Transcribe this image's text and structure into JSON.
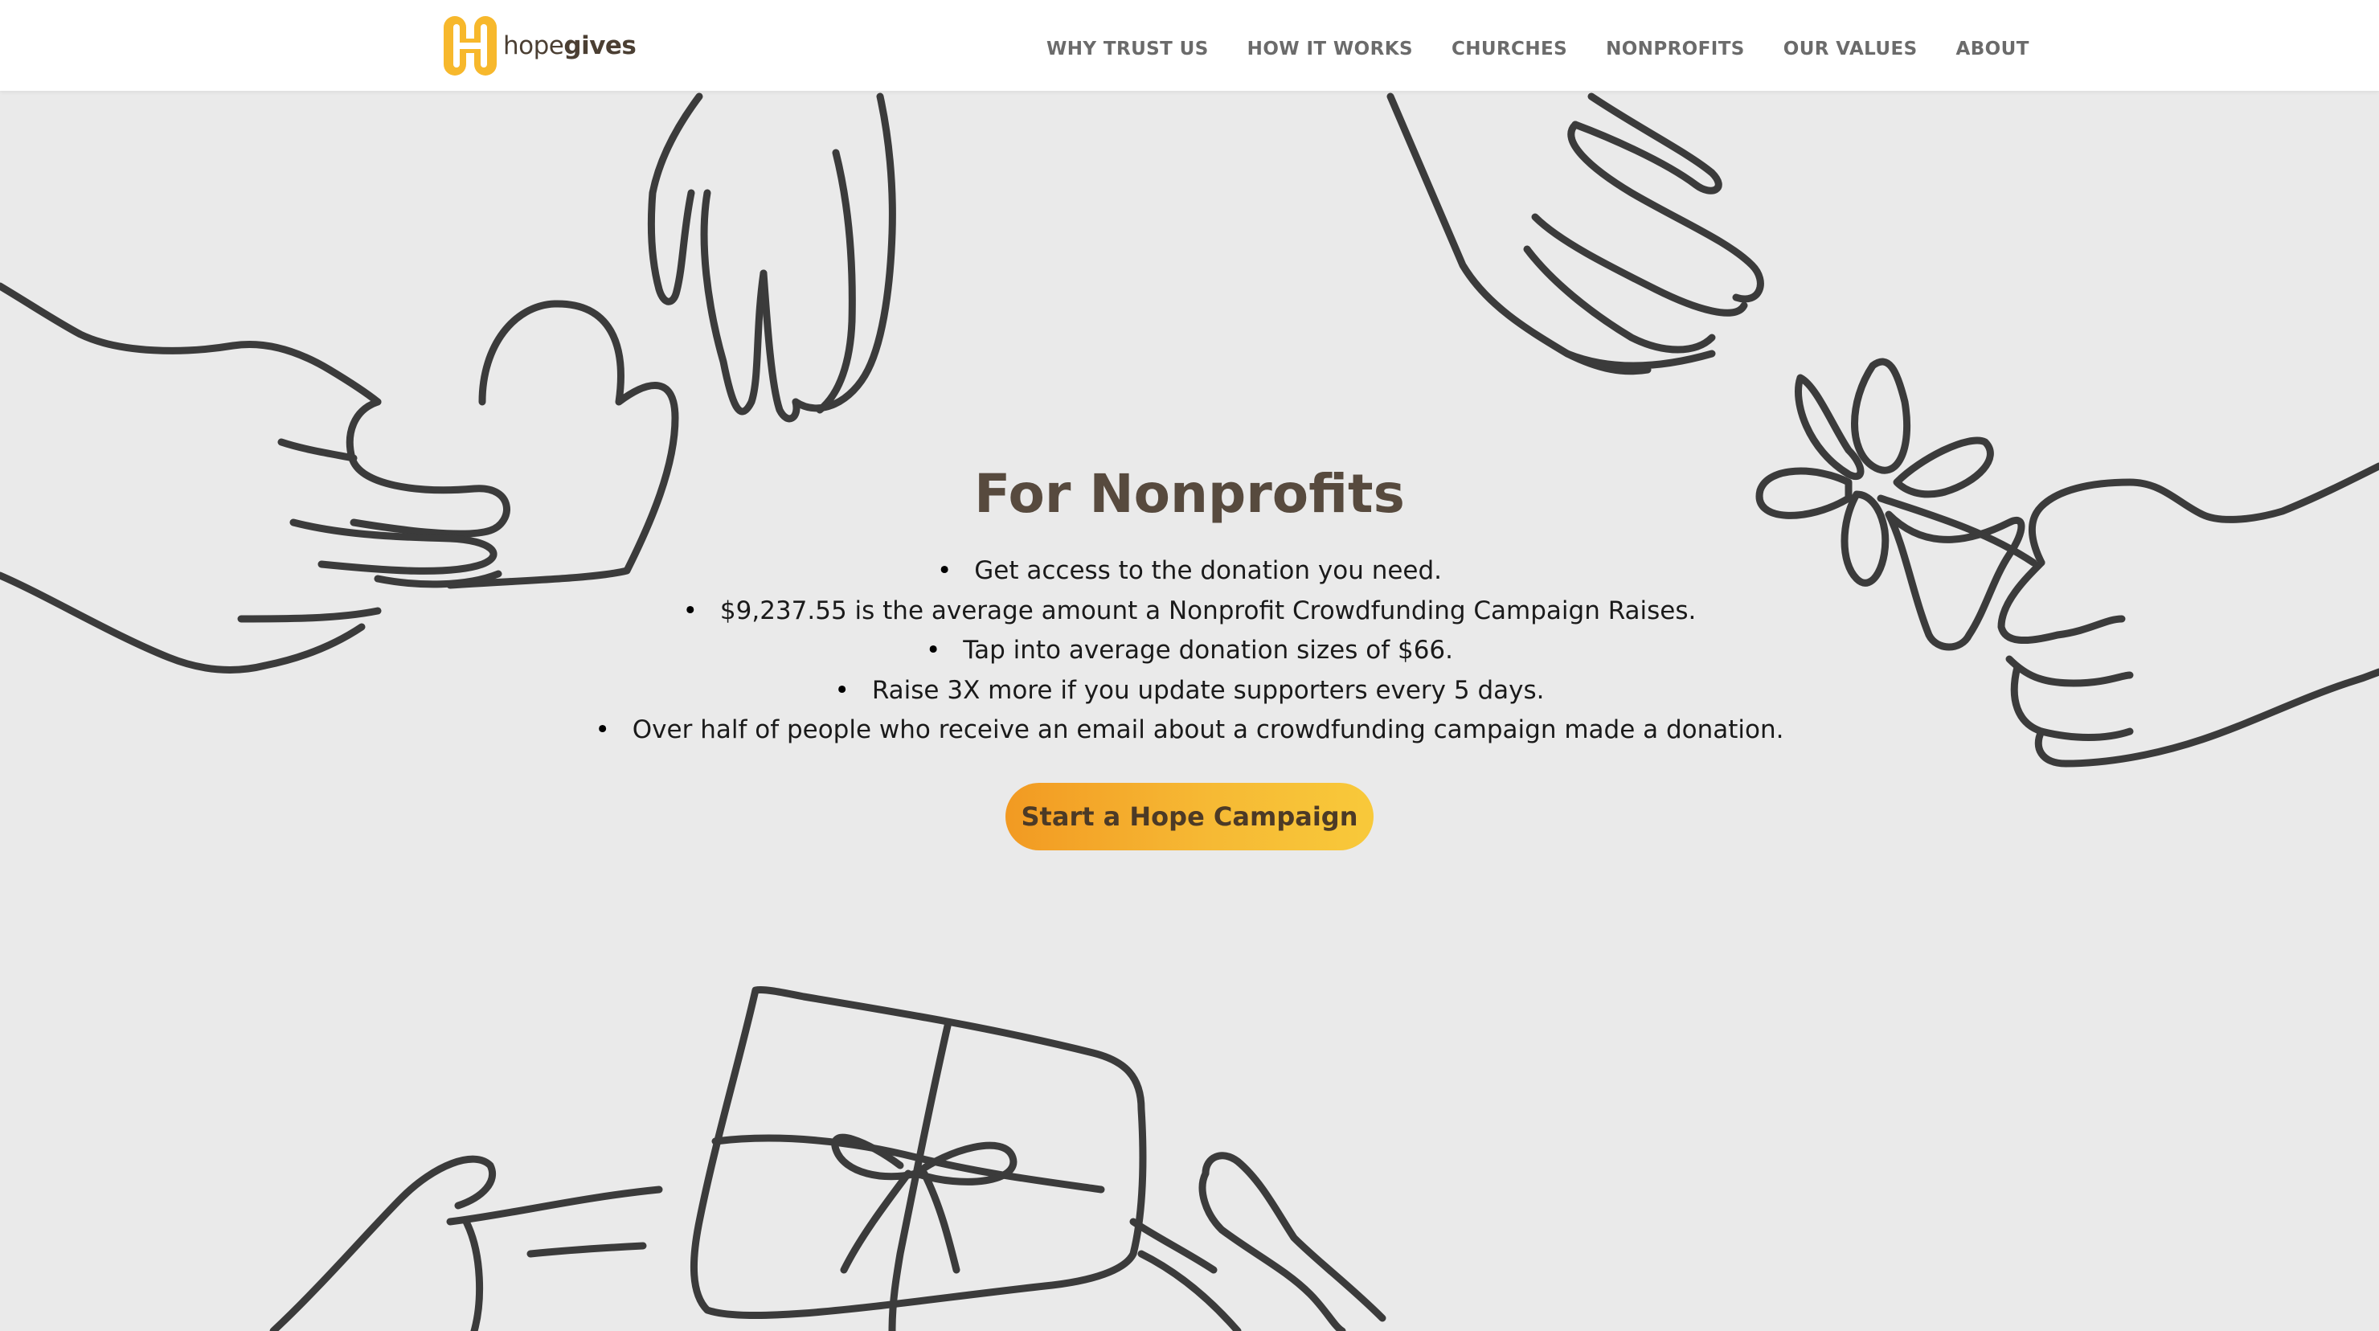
{
  "header": {
    "logo": {
      "letter": "H",
      "text_light": "hope",
      "text_bold": "gives"
    },
    "nav": [
      {
        "label": "WHY TRUST US"
      },
      {
        "label": "HOW IT WORKS"
      },
      {
        "label": "CHURCHES"
      },
      {
        "label": "NONPROFITS"
      },
      {
        "label": "OUR VALUES"
      },
      {
        "label": "ABOUT"
      }
    ]
  },
  "hero": {
    "title": "For Nonprofits",
    "bullets": [
      "Get access to the donation you need.",
      "$9,237.55 is the average amount a Nonprofit Crowdfunding Campaign Raises.",
      "Tap into average donation sizes of $66.",
      "Raise 3X more if you update supporters every 5 days.",
      "Over half of people who receive an email about a crowdfunding campaign made a donation."
    ],
    "cta_label": "Start a Hope Campaign"
  },
  "colors": {
    "background": "#eaeaea",
    "header_bg": "#ffffff",
    "title": "#574a3e",
    "nav_text": "#6b6b6b",
    "logo_yellow": "#f7b82c",
    "cta_gradient_start": "#f29a22",
    "cta_gradient_end": "#f8c93a",
    "line_art": "#3b3b3b"
  },
  "illustrations": [
    "hand-holding-heart-icon",
    "reaching-hand-icon",
    "open-hand-icon",
    "hand-holding-flower-icon",
    "hands-holding-gift-icon"
  ]
}
